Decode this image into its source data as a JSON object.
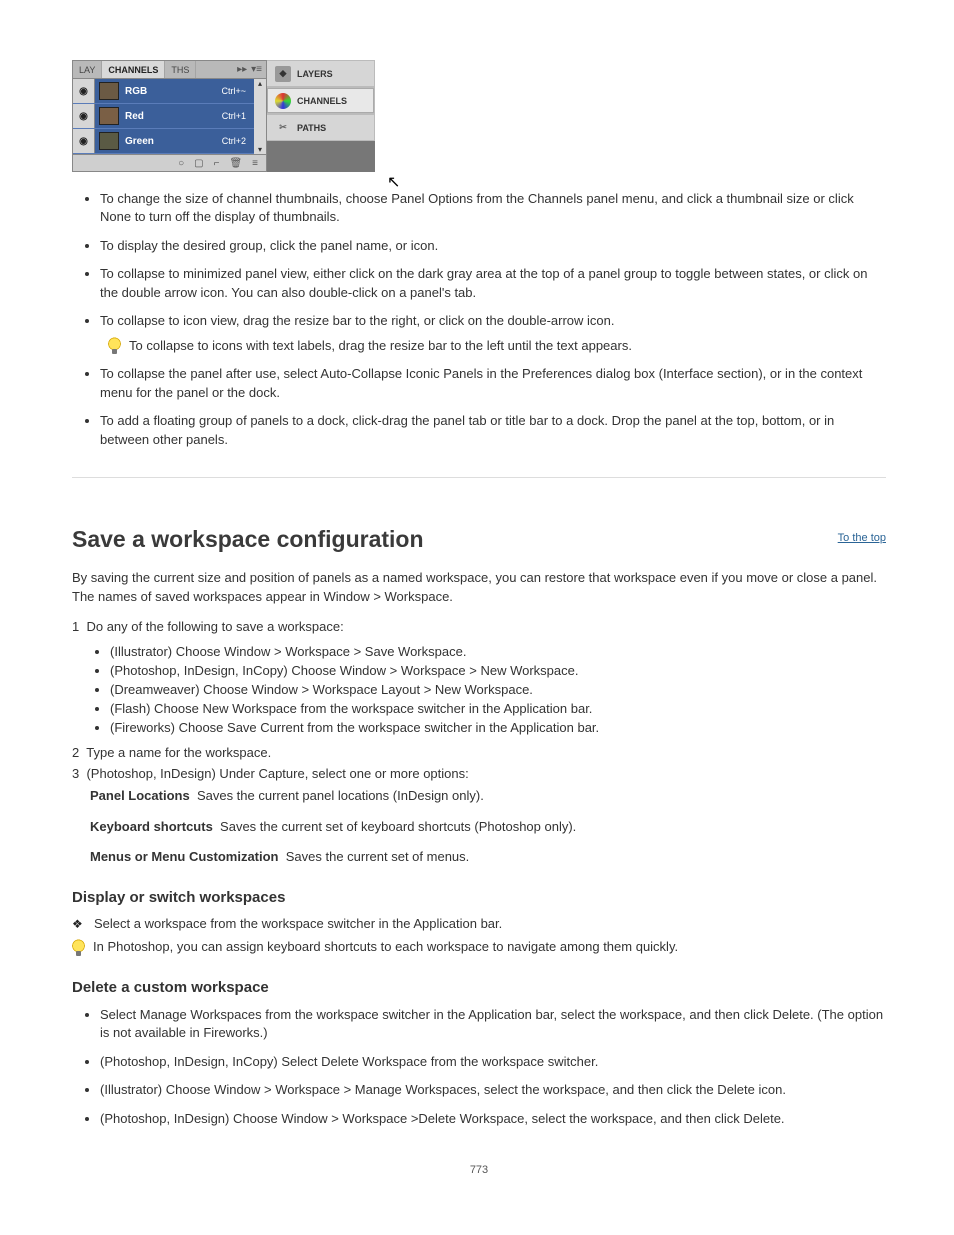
{
  "channels_panel": {
    "tabs": {
      "lay": "LAY",
      "channels": "CHANNELS",
      "ths": "THS",
      "arrows": "▸▸",
      "menu": "▾≡"
    },
    "rows": [
      {
        "name": "RGB",
        "shortcut": "Ctrl+~"
      },
      {
        "name": "Red",
        "shortcut": "Ctrl+1"
      },
      {
        "name": "Green",
        "shortcut": "Ctrl+2"
      }
    ],
    "footer_icons": [
      "○",
      "▢",
      "⌐",
      "🗑",
      "≡"
    ]
  },
  "icon_strip": {
    "layers": "LAYERS",
    "channels": "CHANNELS",
    "paths": "PATHS"
  },
  "bullets_top": [
    "To change the size of channel thumbnails, choose Panel Options from the Channels panel menu, and click a thumbnail size or click None to turn off the display of thumbnails.",
    "To display the desired group, click the panel name, or icon.",
    "To collapse to minimized panel view, either click on the dark gray area at the top of a panel group to toggle between states, or click on the double arrow icon. You can also double-click on a panel's tab.",
    "To collapse to icon view, drag the resize bar to the right, or click on the double-arrow icon."
  ],
  "tip1": "To collapse to icons with text labels, drag the resize bar to the left until the text appears.",
  "bullets_top2": [
    "To collapse the panel after use, select Auto-Collapse Iconic Panels in the Preferences dialog box (Interface section), or in the context menu for the panel or the dock.",
    "To add a floating group of panels to a dock, click-drag the panel tab or title bar to a dock. Drop the panel at the top, bottom, or in between other panels."
  ],
  "heading_save": "Save a workspace configuration",
  "save_intro": "By saving the current size and position of panels as a named workspace, you can restore that workspace even if you move or close a panel. The names of saved workspaces appear in Window > Workspace.",
  "save_step1": {
    "num": "1",
    "text": "Do any of the following to save a workspace:"
  },
  "save_inner": [
    "(Illustrator) Choose Window > Workspace > Save Workspace.",
    "(Photoshop, InDesign, InCopy) Choose Window > Workspace > New Workspace.",
    "(Dreamweaver) Choose Window > Workspace Layout > New Workspace.",
    "(Flash) Choose New Workspace from the workspace switcher in the Application bar.",
    "(Fireworks) Choose Save Current from the workspace switcher in the Application bar."
  ],
  "save_step2": {
    "num": "2",
    "text": "Type a name for the workspace."
  },
  "save_step3": {
    "num": "3",
    "text": "(Photoshop, InDesign) Under Capture, select one or more options:"
  },
  "def_panel": {
    "label": "Panel Locations",
    "text": "Saves the current panel locations (InDesign only)."
  },
  "def_shortcut": {
    "label": "Keyboard shortcuts",
    "text": "Saves the current set of keyboard shortcuts (Photoshop only)."
  },
  "def_menus": {
    "label": "Menus or Menu Customization",
    "text": "Saves the current set of menus."
  },
  "heading_display": "Display or switch workspaces",
  "display_line": "Select a workspace from the workspace switcher in the Application bar.",
  "tip2": "In Photoshop, you can assign keyboard shortcuts to each workspace to navigate among them quickly.",
  "heading_delete": "Delete a custom workspace",
  "del_bullets": [
    "Select Manage Workspaces from the workspace switcher in the Application bar, select the workspace, and then click Delete. (The option is not available in Fireworks.)",
    "(Photoshop, InDesign, InCopy) Select Delete Workspace from the workspace switcher.",
    "(Illustrator) Choose Window > Workspace > Manage Workspaces, select the workspace, and then click the Delete icon.",
    "(Photoshop, InDesign) Choose Window > Workspace >Delete Workspace, select the workspace, and then click Delete."
  ],
  "to_top": "To the top",
  "page_number": "773"
}
